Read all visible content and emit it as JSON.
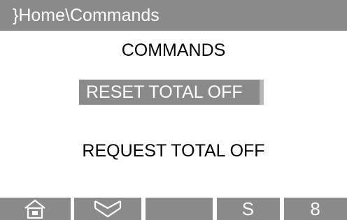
{
  "titlebar": {
    "path": "}Home\\Commands"
  },
  "screen": {
    "heading": "COMMANDS"
  },
  "commands": {
    "reset_total_off": "RESET TOTAL OFF",
    "request_total_off": "REQUEST TOTAL OFF",
    "selected": "RESET TOTAL OFF"
  },
  "softkeys": [
    {
      "icon": "home-icon",
      "label": ""
    },
    {
      "icon": "double-chevron-down-icon",
      "label": ""
    },
    {
      "icon": "",
      "label": ""
    },
    {
      "icon": "",
      "label": "S"
    },
    {
      "icon": "",
      "label": "8"
    }
  ],
  "colors": {
    "bar": "#8a8a8a",
    "background": "#ffffff",
    "text": "#000000",
    "highlight_text": "#ffffff"
  }
}
